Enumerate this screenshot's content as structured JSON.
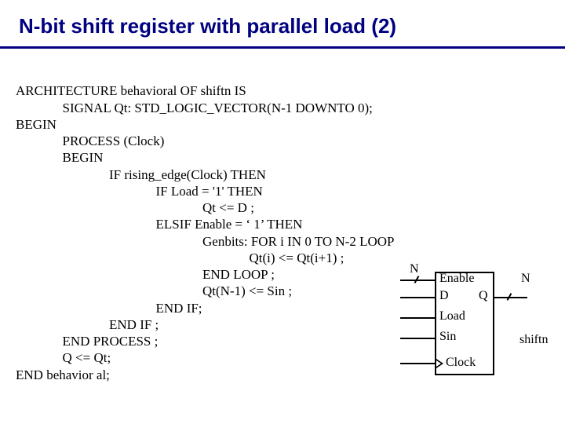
{
  "title": "N-bit shift register with parallel load (2)",
  "code": {
    "l01": "ARCHITECTURE behavioral OF shiftn IS",
    "l02": "              SIGNAL Qt: STD_LOGIC_VECTOR(N-1 DOWNTO 0);",
    "l03": "BEGIN",
    "l04": "              PROCESS (Clock)",
    "l05": "              BEGIN",
    "l06": "                            IF rising_edge(Clock) THEN",
    "l07": "                                          IF Load = '1' THEN",
    "l08": "                                                        Qt <= D ;",
    "l09": "                                          ELSIF Enable = ‘ 1’ THEN",
    "l10": "                                                        Genbits: FOR i IN 0 TO N-2 LOOP",
    "l11": "                                                                      Qt(i) <= Qt(i+1) ;",
    "l12": "                                                        END LOOP ;",
    "l13": "                                                        Qt(N-1) <= Sin ;",
    "l14": "                                          END IF;",
    "l15": "                            END IF ;",
    "l16": "              END PROCESS ;",
    "l17": "              Q <= Qt;",
    "l18": "END behavior al;"
  },
  "diagram": {
    "n_left": "N",
    "n_right": "N",
    "enable": "Enable",
    "d": "D",
    "q": "Q",
    "load": "Load",
    "sin": "Sin",
    "clock": "Clock",
    "name": "shiftn"
  }
}
